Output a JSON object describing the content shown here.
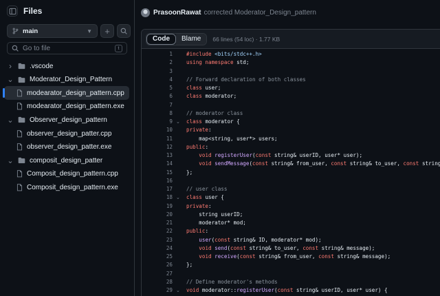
{
  "sidebar": {
    "title": "Files",
    "branch": "main",
    "goto_placeholder": "Go to file",
    "goto_shortcut": "t",
    "tree": [
      {
        "label": ".vscode",
        "type": "folder",
        "depth": 0,
        "expanded": false
      },
      {
        "label": "Moderator_Design_Pattern",
        "type": "folder",
        "depth": 0,
        "expanded": true
      },
      {
        "label": "modearator_design_pattern.cpp",
        "type": "file",
        "depth": 1,
        "selected": true
      },
      {
        "label": "modearator_design_pattern.exe",
        "type": "file",
        "depth": 1
      },
      {
        "label": "Observer_design_pattern",
        "type": "folder",
        "depth": 0,
        "expanded": true
      },
      {
        "label": "observer_design_patter.cpp",
        "type": "file",
        "depth": 1
      },
      {
        "label": "observer_design_patter.exe",
        "type": "file",
        "depth": 1
      },
      {
        "label": "composit_design_patter",
        "type": "folder",
        "depth": 0,
        "expanded": true
      },
      {
        "label": "Composit_design_pattern.cpp",
        "type": "file",
        "depth": 1
      },
      {
        "label": "Composit_design_pattern.exe",
        "type": "file",
        "depth": 1
      }
    ]
  },
  "commit": {
    "author": "PrasoonRawat",
    "message": "corrected Moderator_Design_pattern"
  },
  "file": {
    "tabs": [
      "Code",
      "Blame"
    ],
    "active_tab": "Code",
    "info": "66 lines (54 loc) · 1.77 KB"
  },
  "code": {
    "lines": [
      {
        "n": "1",
        "fold": "",
        "tokens": [
          [
            "pp",
            "#include "
          ],
          [
            "str",
            "<bits/stdc++.h>"
          ]
        ]
      },
      {
        "n": "2",
        "fold": "",
        "tokens": [
          [
            "kw",
            "using namespace "
          ],
          [
            "",
            "std;"
          ]
        ]
      },
      {
        "n": "3",
        "fold": "",
        "tokens": []
      },
      {
        "n": "4",
        "fold": "",
        "tokens": [
          [
            "cm",
            "// Forward declaration of both classes"
          ]
        ]
      },
      {
        "n": "5",
        "fold": "",
        "tokens": [
          [
            "kw",
            "class "
          ],
          [
            "",
            "user;"
          ]
        ]
      },
      {
        "n": "6",
        "fold": "",
        "tokens": [
          [
            "kw",
            "class "
          ],
          [
            "",
            "moderator;"
          ]
        ]
      },
      {
        "n": "7",
        "fold": "",
        "tokens": []
      },
      {
        "n": "8",
        "fold": "",
        "tokens": [
          [
            "cm",
            "// moderator class"
          ]
        ]
      },
      {
        "n": "9",
        "fold": "v",
        "tokens": [
          [
            "kw",
            "class "
          ],
          [
            "",
            "moderator {"
          ]
        ]
      },
      {
        "n": "10",
        "fold": "",
        "tokens": [
          [
            "kw",
            "private"
          ],
          [
            "",
            ":"
          ]
        ]
      },
      {
        "n": "11",
        "fold": "",
        "tokens": [
          [
            "",
            "    map<string, user*> users;"
          ]
        ]
      },
      {
        "n": "12",
        "fold": "",
        "tokens": [
          [
            "kw",
            "public"
          ],
          [
            "",
            ":"
          ]
        ]
      },
      {
        "n": "13",
        "fold": "",
        "tokens": [
          [
            "",
            "    "
          ],
          [
            "kw",
            "void "
          ],
          [
            "fn",
            "registerUser"
          ],
          [
            "",
            "("
          ],
          [
            "kw",
            "const "
          ],
          [
            "",
            "string& userID, user* user);"
          ]
        ]
      },
      {
        "n": "14",
        "fold": "",
        "tokens": [
          [
            "",
            "    "
          ],
          [
            "kw",
            "void "
          ],
          [
            "fn",
            "sendMessage"
          ],
          [
            "",
            "("
          ],
          [
            "kw",
            "const "
          ],
          [
            "",
            "string& from_user, "
          ],
          [
            "kw",
            "const "
          ],
          [
            "",
            "string& to_user, "
          ],
          [
            "kw",
            "const "
          ],
          [
            "",
            "string& message);"
          ]
        ]
      },
      {
        "n": "15",
        "fold": "",
        "tokens": [
          [
            "",
            "};"
          ]
        ]
      },
      {
        "n": "16",
        "fold": "",
        "tokens": []
      },
      {
        "n": "17",
        "fold": "",
        "tokens": [
          [
            "cm",
            "// user class"
          ]
        ]
      },
      {
        "n": "18",
        "fold": "v",
        "tokens": [
          [
            "kw",
            "class "
          ],
          [
            "",
            "user {"
          ]
        ]
      },
      {
        "n": "19",
        "fold": "",
        "tokens": [
          [
            "kw",
            "private"
          ],
          [
            "",
            ":"
          ]
        ]
      },
      {
        "n": "20",
        "fold": "",
        "tokens": [
          [
            "",
            "    string userID;"
          ]
        ]
      },
      {
        "n": "21",
        "fold": "",
        "tokens": [
          [
            "",
            "    moderator* mod;"
          ]
        ]
      },
      {
        "n": "22",
        "fold": "",
        "tokens": [
          [
            "kw",
            "public"
          ],
          [
            "",
            ":"
          ]
        ]
      },
      {
        "n": "23",
        "fold": "",
        "tokens": [
          [
            "",
            "    "
          ],
          [
            "fn",
            "user"
          ],
          [
            "",
            "("
          ],
          [
            "kw",
            "const "
          ],
          [
            "",
            "string& ID, moderator* mod);"
          ]
        ]
      },
      {
        "n": "24",
        "fold": "",
        "tokens": [
          [
            "",
            "    "
          ],
          [
            "kw",
            "void "
          ],
          [
            "fn",
            "send"
          ],
          [
            "",
            "("
          ],
          [
            "kw",
            "const "
          ],
          [
            "",
            "string& to_user, "
          ],
          [
            "kw",
            "const "
          ],
          [
            "",
            "string& message);"
          ]
        ]
      },
      {
        "n": "25",
        "fold": "",
        "tokens": [
          [
            "",
            "    "
          ],
          [
            "kw",
            "void "
          ],
          [
            "fn",
            "receive"
          ],
          [
            "",
            "("
          ],
          [
            "kw",
            "const "
          ],
          [
            "",
            "string& from_user, "
          ],
          [
            "kw",
            "const "
          ],
          [
            "",
            "string& message);"
          ]
        ]
      },
      {
        "n": "26",
        "fold": "",
        "tokens": [
          [
            "",
            "};"
          ]
        ]
      },
      {
        "n": "27",
        "fold": "",
        "tokens": []
      },
      {
        "n": "28",
        "fold": "",
        "tokens": [
          [
            "cm",
            "// Define moderator's methods"
          ]
        ]
      },
      {
        "n": "29",
        "fold": "v",
        "tokens": [
          [
            "kw",
            "void "
          ],
          [
            "",
            "moderator::"
          ],
          [
            "fn",
            "registerUser"
          ],
          [
            "",
            "("
          ],
          [
            "kw",
            "const "
          ],
          [
            "",
            "string& userID, user* user) {"
          ]
        ]
      }
    ]
  },
  "colors": {
    "accent": "#2f81f7",
    "keyword": "#ff7b72",
    "function": "#d2a8ff",
    "comment": "#8b949e",
    "string": "#a5d6ff"
  }
}
